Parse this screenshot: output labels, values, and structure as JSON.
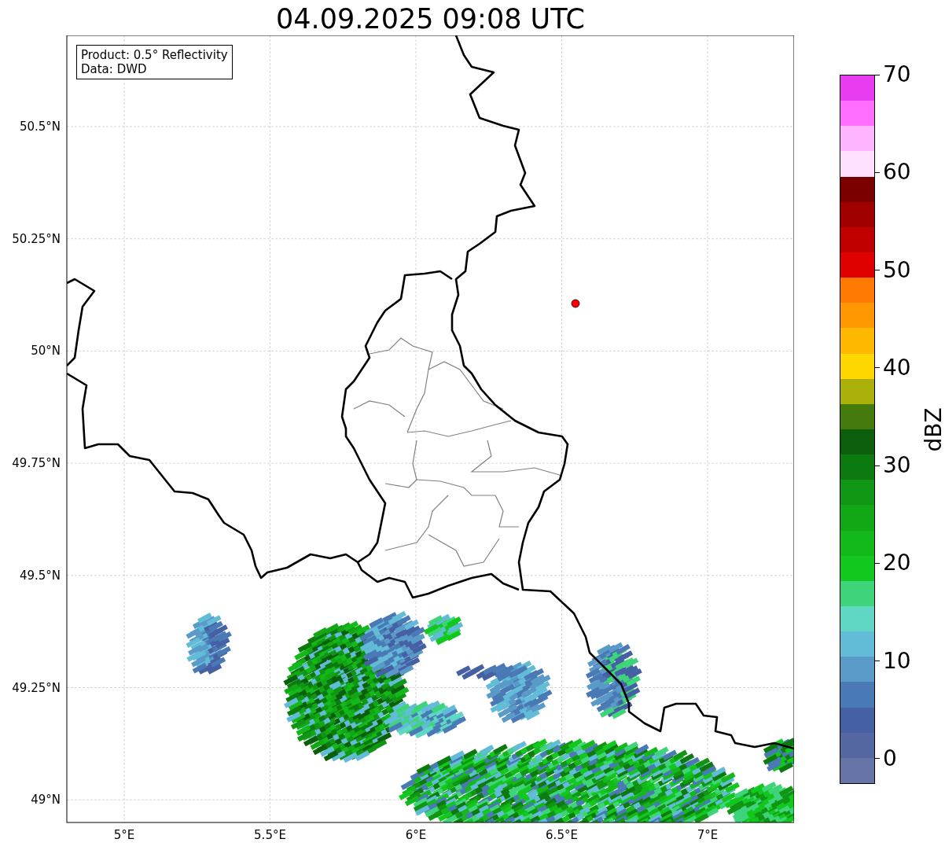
{
  "title": "04.09.2025 09:08 UTC",
  "info_box": [
    "Product: 0.5° Reflectivity",
    "Data: DWD"
  ],
  "lat_ticks": [
    "50.5°N",
    "50.25°N",
    "50°N",
    "49.75°N",
    "49.5°N",
    "49.25°N",
    "49°N"
  ],
  "lon_ticks": [
    "5°E",
    "5.5°E",
    "6°E",
    "6.5°E",
    "7°E"
  ],
  "colorbar": {
    "label": "dBZ",
    "ticks": [
      "70",
      "60",
      "50",
      "40",
      "30",
      "20",
      "10",
      "0"
    ],
    "bands": [
      {
        "color": "#e83cf0"
      },
      {
        "color": "#ff6eff"
      },
      {
        "color": "#ffb4ff"
      },
      {
        "color": "#ffe0ff"
      },
      {
        "color": "#7a0000"
      },
      {
        "color": "#a00000"
      },
      {
        "color": "#c00000"
      },
      {
        "color": "#e00000"
      },
      {
        "color": "#ff7a00"
      },
      {
        "color": "#ff9800"
      },
      {
        "color": "#ffb800"
      },
      {
        "color": "#ffd700"
      },
      {
        "color": "#aab008"
      },
      {
        "color": "#457a0c"
      },
      {
        "color": "#0a5e0c"
      },
      {
        "color": "#0d7a10"
      },
      {
        "color": "#109614"
      },
      {
        "color": "#12a815"
      },
      {
        "color": "#13b81a"
      },
      {
        "color": "#12c81e"
      },
      {
        "color": "#3ed47a"
      },
      {
        "color": "#5fd7c4"
      },
      {
        "color": "#62bcd8"
      },
      {
        "color": "#5a9ac8"
      },
      {
        "color": "#4a7ab5"
      },
      {
        "color": "#4560a3"
      },
      {
        "color": "#5567a0"
      },
      {
        "color": "#6674a8"
      }
    ]
  }
}
